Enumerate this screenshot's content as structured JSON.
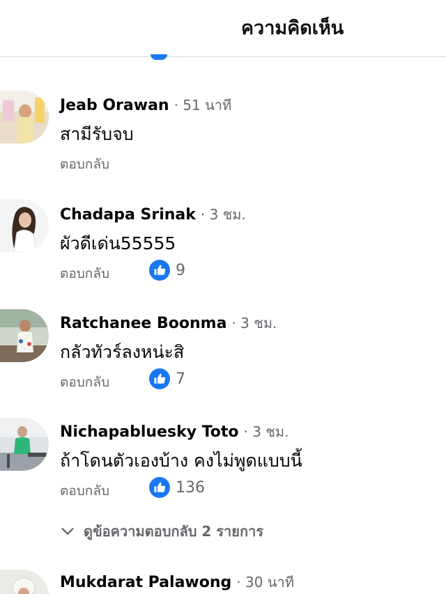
{
  "header": {
    "title": "ความคิดเห็น"
  },
  "comments": [
    {
      "name": "Jeab Orawan",
      "time": "· 51 นาที",
      "text": "สามีรับจบ",
      "reply": "ตอบกลับ",
      "likes": ""
    },
    {
      "name": "Chadapa Srinak",
      "time": "· 3 ชม.",
      "text": "ผัวดีเด่น55555",
      "reply": "ตอบกลับ",
      "likes": "9"
    },
    {
      "name": "Ratchanee Boonma",
      "time": "· 3 ชม.",
      "text": "กลัวทัวร์ลงหน่ะสิ",
      "reply": "ตอบกลับ",
      "likes": "7"
    },
    {
      "name": "Nichapabluesky Toto",
      "time": "· 3 ชม.",
      "text": "ถ้าโดนตัวเองบ้าง  คงไม่พูดแบบนี้",
      "reply": "ตอบกลับ",
      "likes": "136"
    },
    {
      "name": "Mukdarat Palawong",
      "time": "· 30 นาที",
      "text": "",
      "reply": "",
      "likes": ""
    }
  ],
  "more_replies": "ดูข้อความตอบกลับ 2 รายการ",
  "colors": {
    "accent": "#1877f2",
    "secondary_text": "#65676b"
  },
  "icons": {
    "like": "thumbs-up-icon",
    "expand": "chevron-down-icon"
  }
}
